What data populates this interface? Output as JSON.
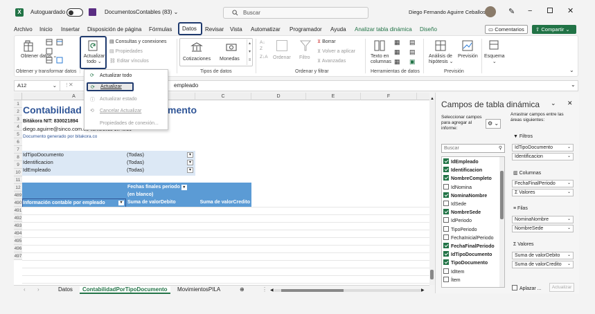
{
  "titlebar": {
    "autosave_label": "Autoguardado",
    "filename": "DocumentosContables (83)",
    "search_placeholder": "Buscar",
    "user_name": "Diego Fernando Aguirre Ceballos"
  },
  "menu": {
    "items": [
      "Archivo",
      "Inicio",
      "Insertar",
      "Disposición de página",
      "Fórmulas",
      "Datos",
      "Revisar",
      "Vista",
      "Automatizar",
      "Programador",
      "Ayuda",
      "Analizar tabla dinámica",
      "Diseño"
    ],
    "comments": "Comentarios",
    "share": "Compartir"
  },
  "ribbon": {
    "get_data": "Obtener datos",
    "refresh_all": [
      "Actualizar",
      "todo"
    ],
    "queries": "Consultas y conexiones",
    "properties": "Propiedades",
    "edit_links": "Editar vínculos",
    "stocks": "Cotizaciones",
    "currencies": "Monedas",
    "sort": "Ordenar",
    "filter": "Filtro",
    "clear": "Borrar",
    "reapply": "Volver a aplicar",
    "advanced": "Avanzadas",
    "text_to_columns": [
      "Texto en",
      "columnas"
    ],
    "what_if": [
      "Análisis de",
      "hipótesis"
    ],
    "forecast": "Previsión",
    "outline": "Esquema",
    "group_labels": [
      "Obtener y transformar datos",
      "Tipos de datos",
      "Ordenar y filtrar",
      "Herramientas de datos",
      "Previsión"
    ]
  },
  "formula_bar": {
    "cell_ref": "A12",
    "content": "empleado"
  },
  "dropdown": {
    "items": [
      "Actualizar todo",
      "Actualizar",
      "Actualizar estado",
      "Cancelar Actualizar",
      "Propiedades de conexión..."
    ]
  },
  "sheet": {
    "columns": [
      "A",
      "B",
      "C",
      "D",
      "E",
      "F"
    ],
    "rows": [
      "1",
      "2",
      "3",
      "4",
      "5",
      "6",
      "7",
      "8",
      "9",
      "10",
      "11",
      "12",
      "489",
      "490",
      "491",
      "492",
      "493",
      "494",
      "495",
      "496",
      "497"
    ],
    "title": "Contabilidad",
    "title_tail": "mento",
    "nit": "Bitákora NIT: 830021894",
    "email": "diego.aguirre@sinco.com.co",
    "datetime": "02/05/2023 10:46:21",
    "generated": "Documento generado por bitakora.co",
    "filters": [
      {
        "label": "IdTipoDocumento",
        "value": "(Todas)"
      },
      {
        "label": "Identificacion",
        "value": "(Todas)"
      },
      {
        "label": "IdEmpleado",
        "value": "(Todas)"
      }
    ],
    "pivot_col_header": "Fechas finales periodo",
    "pivot_col_value": "(en blanco)",
    "pivot_row_header": "Información contable por empleado",
    "sum_debito": "Suma de valorDebito",
    "sum_credito": "Suma de valorCredito"
  },
  "tabs": {
    "items": [
      "Datos",
      "ContabilidadPorTipoDocumento",
      "MovimientosPILA"
    ],
    "active": "ContabilidadPorTipoDocumento"
  },
  "pane": {
    "title": "Campos de tabla dinámica",
    "select_fields": "Seleccionar campos para agregar al informe:",
    "drag_hint": "Arrastrar campos entre las áreas siguientes:",
    "search_placeholder": "Buscar",
    "fields": [
      {
        "name": "IdEmpleado",
        "checked": true
      },
      {
        "name": "Identificacion",
        "checked": true
      },
      {
        "name": "NombreCompleto",
        "checked": true
      },
      {
        "name": "IdNomina",
        "checked": false
      },
      {
        "name": "NominaNombre",
        "checked": true
      },
      {
        "name": "IdSede",
        "checked": false
      },
      {
        "name": "NombreSede",
        "checked": true
      },
      {
        "name": "IdPeriodo",
        "checked": false
      },
      {
        "name": "TipoPeriodo",
        "checked": false
      },
      {
        "name": "FechaInicialPeriodo",
        "checked": false
      },
      {
        "name": "FechaFinalPeriodo",
        "checked": true
      },
      {
        "name": "IdTipoDocumento",
        "checked": true
      },
      {
        "name": "TipoDocumento",
        "checked": true
      },
      {
        "name": "IdItem",
        "checked": false
      },
      {
        "name": "Ítem",
        "checked": false
      }
    ],
    "filters_label": "Filtros",
    "filters_items": [
      "IdTipoDocumento",
      "Identificacion"
    ],
    "columns_label": "Columnas",
    "columns_items": [
      "FechaFinalPeriodo",
      "Σ Valores"
    ],
    "rows_label": "Filas",
    "rows_items": [
      "NominaNombre",
      "NombreSede"
    ],
    "values_label": "Valores",
    "values_items": [
      "Suma de valorDebito",
      "Suma de valorCredito"
    ],
    "defer": "Aplazar ...",
    "update": "Actualizar"
  },
  "colors": {
    "accent_green": "#217346",
    "pivot_blue": "#5b9bd5",
    "pivot_light": "#dce8f5",
    "title_blue": "#2f5597",
    "highlight": "#1f3a6e"
  }
}
